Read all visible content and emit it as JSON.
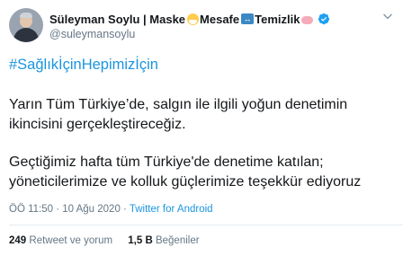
{
  "header": {
    "display_name_part1": "Süleyman Soylu | Maske",
    "display_name_part2": " Mesafe",
    "display_name_part3": " Temizlik",
    "username": "@suleymansoylu"
  },
  "tweet": {
    "hashtag": "#SağlıkİçinHepimizİçin",
    "paragraph1": "Yarın Tüm Türkiye’de, salgın ile ilgili yoğun denetimin ikincisini gerçekleştireceğiz.",
    "paragraph2": "Geçtiğimiz hafta tüm Türkiye'de denetime katılan; yöneticilerimize ve kolluk güçlerimize teşekkür ediyoruz",
    "time": "ÖÖ 11:50",
    "separator": " · ",
    "date": "10 Ağu 2020",
    "client": "Twitter for Android"
  },
  "stats": {
    "retweets_count": "249",
    "retweets_label": " Retweet ve yorum",
    "likes_count": "1,5 B",
    "likes_label": " Beğeniler"
  },
  "colors": {
    "link": "#1b95e0",
    "secondary_text": "#657786",
    "primary_text": "#14171a"
  },
  "icons": [
    "mask-emoji-icon",
    "left-right-arrow-emoji-icon",
    "soap-emoji-icon",
    "verified-badge-icon",
    "chevron-down-icon"
  ]
}
